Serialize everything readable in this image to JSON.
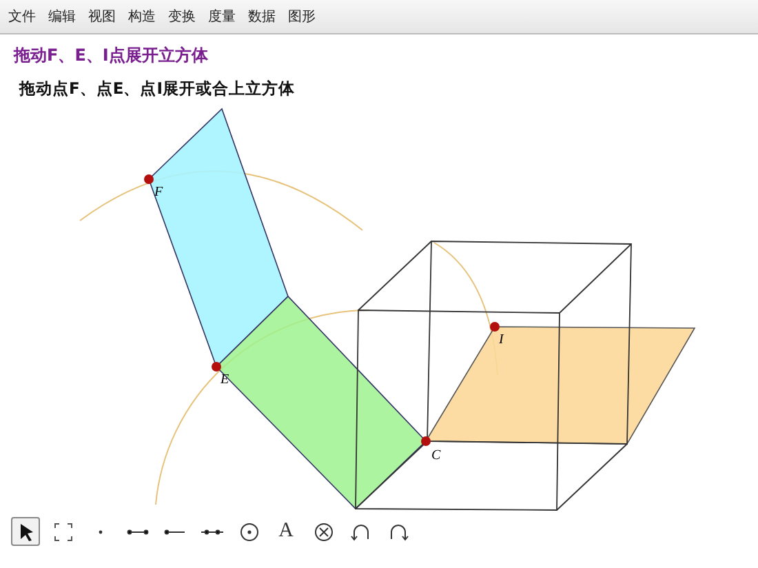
{
  "menu": [
    "文件",
    "编辑",
    "视图",
    "构造",
    "变换",
    "度量",
    "数据",
    "图形"
  ],
  "title": "拖动F、E、I点展开立方体",
  "subtitle": "拖动点F、点E、点I展开或合上立方体",
  "points": [
    {
      "label": "F"
    },
    {
      "label": "E"
    },
    {
      "label": "I"
    },
    {
      "label": "C"
    }
  ],
  "tools": [
    {
      "kind": "arrow",
      "selected": true
    },
    {
      "kind": "select",
      "selected": false
    },
    {
      "kind": "point",
      "selected": false
    },
    {
      "kind": "segment",
      "selected": false
    },
    {
      "kind": "ray",
      "selected": false
    },
    {
      "kind": "line",
      "selected": false
    },
    {
      "kind": "circle",
      "selected": false
    },
    {
      "kind": "text",
      "label": "A",
      "selected": false
    },
    {
      "kind": "cross",
      "selected": false
    },
    {
      "kind": "undo",
      "selected": false
    },
    {
      "kind": "redo",
      "selected": false
    }
  ]
}
